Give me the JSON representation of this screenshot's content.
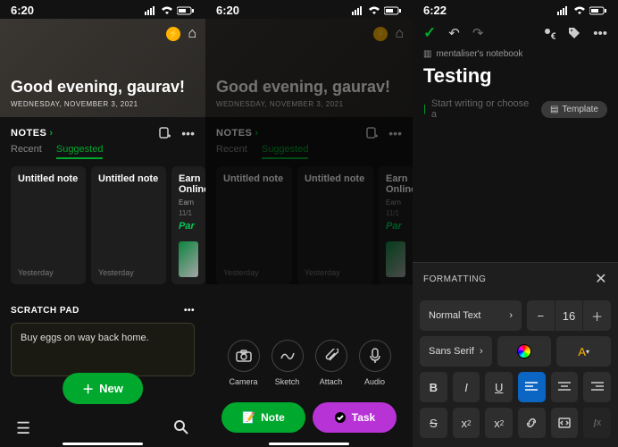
{
  "status": {
    "time1": "6:20",
    "time2": "6:20",
    "time3": "6:22"
  },
  "hero": {
    "greeting": "Good evening, gaurav!",
    "date": "WEDNESDAY, NOVEMBER 3, 2021"
  },
  "notes": {
    "section_label": "NOTES",
    "tabs": {
      "recent": "Recent",
      "suggested": "Suggested"
    },
    "cards": [
      {
        "title": "Untitled note",
        "when": "Yesterday"
      },
      {
        "title": "Untitled note",
        "when": "Yesterday"
      },
      {
        "title": "Earn Online",
        "sub": "Earn",
        "date": "11/1",
        "par": "Par"
      }
    ]
  },
  "scratch": {
    "label": "SCRATCH PAD",
    "text": "Buy eggs on way back home."
  },
  "fab": {
    "label": "New"
  },
  "quick": {
    "camera": "Camera",
    "sketch": "Sketch",
    "attach": "Attach",
    "audio": "Audio",
    "note": "Note",
    "task": "Task"
  },
  "editor": {
    "notebook": "mentaliser's notebook",
    "title": "Testing",
    "placeholder": "Start writing or choose a",
    "template": "Template"
  },
  "format": {
    "header": "FORMATTING",
    "style": "Normal Text",
    "font": "Sans Serif",
    "size": "16"
  }
}
